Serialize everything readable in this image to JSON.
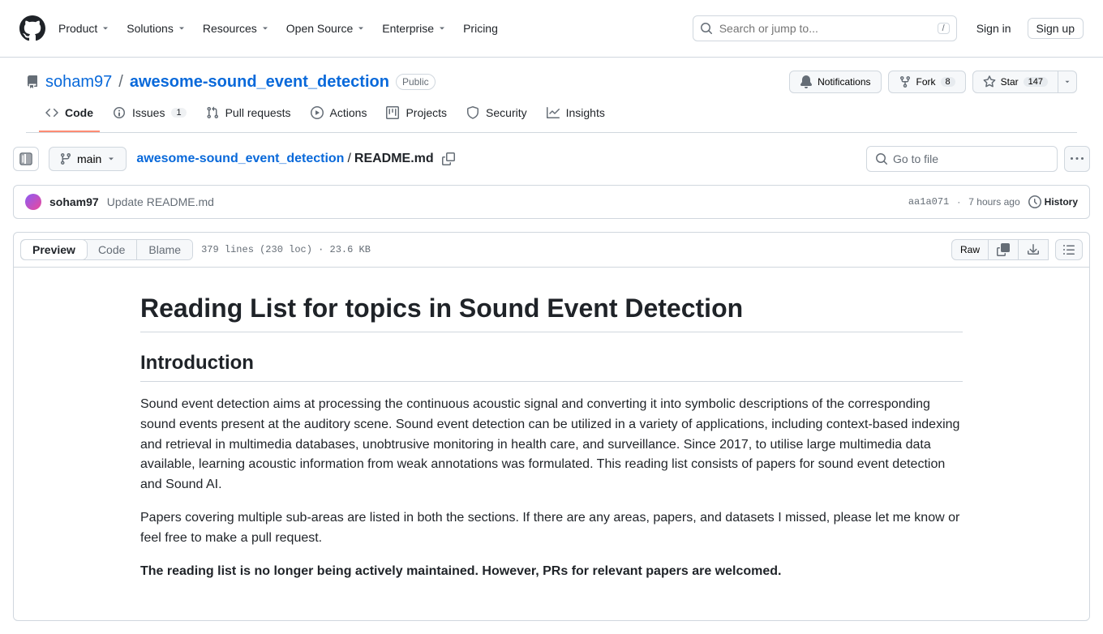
{
  "nav": {
    "product": "Product",
    "solutions": "Solutions",
    "resources": "Resources",
    "open_source": "Open Source",
    "enterprise": "Enterprise",
    "pricing": "Pricing"
  },
  "search": {
    "placeholder": "Search or jump to...",
    "kbd": "/"
  },
  "auth": {
    "sign_in": "Sign in",
    "sign_up": "Sign up"
  },
  "repo": {
    "owner": "soham97",
    "name": "awesome-sound_event_detection",
    "visibility": "Public",
    "actions": {
      "notifications": "Notifications",
      "fork": "Fork",
      "fork_count": "8",
      "star": "Star",
      "star_count": "147"
    }
  },
  "tabs": {
    "code": "Code",
    "issues": "Issues",
    "issues_count": "1",
    "pull_requests": "Pull requests",
    "actions": "Actions",
    "projects": "Projects",
    "security": "Security",
    "insights": "Insights"
  },
  "file_nav": {
    "branch": "main",
    "breadcrumb_root": "awesome-sound_event_detection",
    "breadcrumb_sep": "/",
    "file": "README.md",
    "goto_placeholder": "Go to file"
  },
  "commit": {
    "author": "soham97",
    "message": "Update README.md",
    "hash": "aa1a071",
    "time": "7 hours ago",
    "history": "History"
  },
  "file": {
    "preview": "Preview",
    "code": "Code",
    "blame": "Blame",
    "stats": "379 lines (230 loc) · 23.6 KB",
    "raw": "Raw"
  },
  "content": {
    "h1": "Reading List for topics in Sound Event Detection",
    "h2": "Introduction",
    "p1": "Sound event detection aims at processing the continuous acoustic signal and converting it into symbolic descriptions of the corresponding sound events present at the auditory scene. Sound event detection can be utilized in a variety of applications, including context-based indexing and retrieval in multimedia databases, unobtrusive monitoring in health care, and surveillance. Since 2017, to utilise large multimedia data available, learning acoustic information from weak annotations was formulated. This reading list consists of papers for sound event detection and Sound AI.",
    "p2": "Papers covering multiple sub-areas are listed in both the sections. If there are any areas, papers, and datasets I missed, please let me know or feel free to make a pull request.",
    "p3": "The reading list is no longer being actively maintained. However, PRs for relevant papers are welcomed."
  }
}
